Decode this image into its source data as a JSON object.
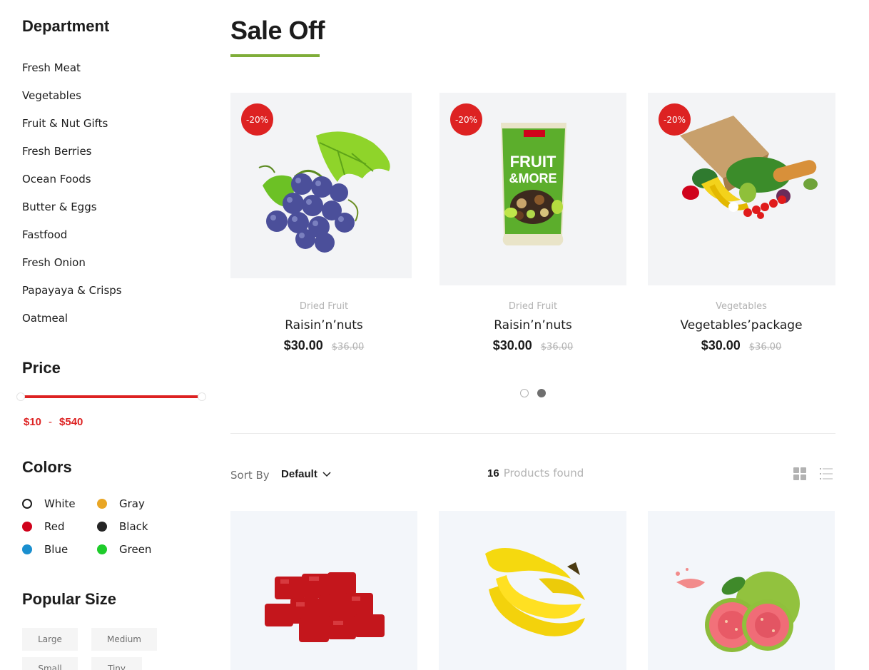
{
  "sidebar": {
    "department": {
      "title": "Department",
      "items": [
        "Fresh Meat",
        "Vegetables",
        "Fruit & Nut Gifts",
        "Fresh Berries",
        "Ocean Foods",
        "Butter & Eggs",
        "Fastfood",
        "Fresh Onion",
        "Papayaya & Crisps",
        "Oatmeal"
      ]
    },
    "price": {
      "title": "Price",
      "min": "$10",
      "sep": "-",
      "max": "$540",
      "range_fill": 1.0
    },
    "colors": {
      "title": "Colors",
      "items": [
        {
          "label": "White",
          "hex": "#ffffff"
        },
        {
          "label": "Gray",
          "hex": "#e9a625"
        },
        {
          "label": "Red",
          "hex": "#d0021b"
        },
        {
          "label": "Black",
          "hex": "#252525"
        },
        {
          "label": "Blue",
          "hex": "#1a8fcf"
        },
        {
          "label": "Green",
          "hex": "#1ecc2b"
        }
      ]
    },
    "sizes": {
      "title": "Popular Size",
      "items": [
        "Large",
        "Medium",
        "Small",
        "Tiny"
      ]
    }
  },
  "sale": {
    "title": "Sale Off",
    "accent": "#7fad39",
    "items": [
      {
        "badge": "-20%",
        "category": "Dried Fruit",
        "name": "Raisin’n’nuts",
        "price": "$30.00",
        "old_price": "$36.00",
        "image": "grapes"
      },
      {
        "badge": "-20%",
        "category": "Dried Fruit",
        "name": "Raisin’n’nuts",
        "price": "$30.00",
        "old_price": "$36.00",
        "image": "fruit-and-more-bag"
      },
      {
        "badge": "-20%",
        "category": "Vegetables",
        "name": "Vegetables’package",
        "price": "$30.00",
        "old_price": "$36.00",
        "image": "vegetable-bag"
      }
    ],
    "carousel_active": 2
  },
  "filter": {
    "sort_label": "Sort By",
    "sort_value": "Default",
    "count": "16",
    "found_text": "Products found",
    "views": [
      "grid-icon",
      "list-icon"
    ]
  },
  "products": [
    {
      "image": "beef-cubes"
    },
    {
      "image": "bananas"
    },
    {
      "image": "guava"
    }
  ]
}
